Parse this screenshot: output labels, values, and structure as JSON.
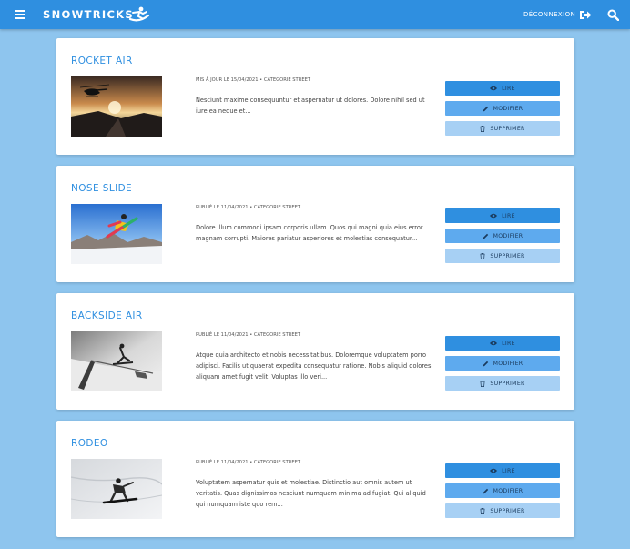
{
  "header": {
    "brand": "SNOWTRICKS",
    "logout_label": "DÉCONNEXION",
    "icons": {
      "menu": "menu-icon",
      "logo": "snowboarder-logo-icon",
      "logout": "sign-out-icon",
      "search": "search-icon"
    },
    "colors": {
      "bar": "#2f8fe0",
      "background": "#8ec5ee"
    }
  },
  "buttons": {
    "read": "LIRE",
    "edit": "MODIFIER",
    "delete": "SUPPRIMER"
  },
  "tricks": [
    {
      "title": "ROCKET AIR",
      "meta": "MIS À JOUR LE 15/04/2021 • CATEGORIE STREET",
      "excerpt": "Nesciunt maxime consequuntur et aspernatur ut dolores. Dolore nihil sed ut iure ea neque et...",
      "image": "helicopter-sunset-photo"
    },
    {
      "title": "NOSE SLIDE",
      "meta": "PUBLIÉ LE 11/04/2021 • CATEGORIE STREET",
      "excerpt": "Dolore illum commodi ipsam corporis ullam. Quos qui magni quia eius error magnam corrupti. Maiores pariatur asperiores et molestias consequatur...",
      "image": "snowboarder-jump-photo"
    },
    {
      "title": "BACKSIDE AIR",
      "meta": "PUBLIÉ LE 11/04/2021 • CATEGORIE STREET",
      "excerpt": "Atque quia architecto et nobis necessitatibus. Doloremque voluptatem porro adipisci. Facilis ut quaerat expedita consequatur ratione. Nobis aliquid dolores aliquam amet fugit velit. Voluptas illo veri...",
      "image": "snowboarder-rail-bw-photo"
    },
    {
      "title": "RODEO",
      "meta": "PUBLIÉ LE 11/04/2021 • CATEGORIE STREET",
      "excerpt": "Voluptatem aspernatur quis et molestiae. Distinctio aut omnis autem ut veritatis. Quas dignissimos nesciunt numquam minima ad fugiat. Qui aliquid qui numquam iste quo rem...",
      "image": "snowboarder-carve-photo"
    }
  ]
}
